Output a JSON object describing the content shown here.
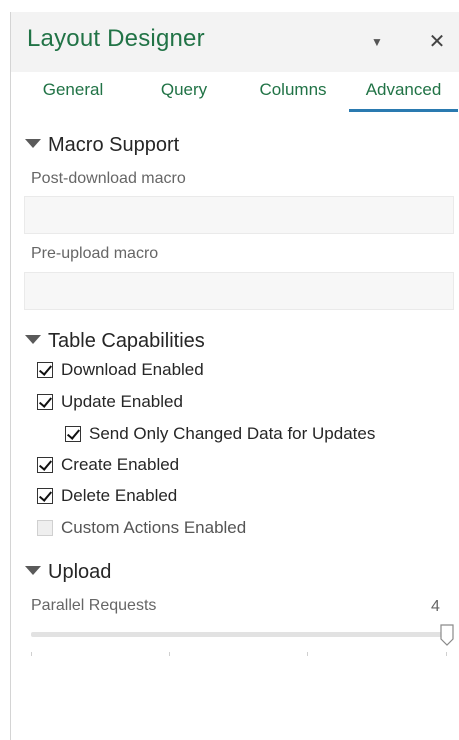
{
  "pane": {
    "title": "Layout Designer",
    "menu_icon": "caret-down-icon",
    "close_icon": "close-icon",
    "accent_color": "#217346",
    "tab_underline_color": "#2a7ab0"
  },
  "tabs": [
    {
      "label": "General",
      "active": false
    },
    {
      "label": "Query",
      "active": false
    },
    {
      "label": "Columns",
      "active": false
    },
    {
      "label": "Advanced",
      "active": true
    }
  ],
  "macro_support": {
    "heading": "Macro Support",
    "post_download_label": "Post-download macro",
    "post_download_value": "",
    "pre_upload_label": "Pre-upload macro",
    "pre_upload_value": ""
  },
  "table_capabilities": {
    "heading": "Table Capabilities",
    "items": [
      {
        "label": "Download Enabled",
        "checked": true,
        "disabled": false
      },
      {
        "label": "Update Enabled",
        "checked": true,
        "disabled": false
      },
      {
        "label": "Send Only Changed Data for Updates",
        "checked": true,
        "disabled": false
      },
      {
        "label": "Create Enabled",
        "checked": true,
        "disabled": false
      },
      {
        "label": "Delete Enabled",
        "checked": true,
        "disabled": false
      },
      {
        "label": "Custom Actions Enabled",
        "checked": false,
        "disabled": true
      }
    ]
  },
  "upload": {
    "heading": "Upload",
    "parallel_requests_label": "Parallel Requests",
    "parallel_requests_value": "4",
    "slider_fraction": 1.0
  }
}
